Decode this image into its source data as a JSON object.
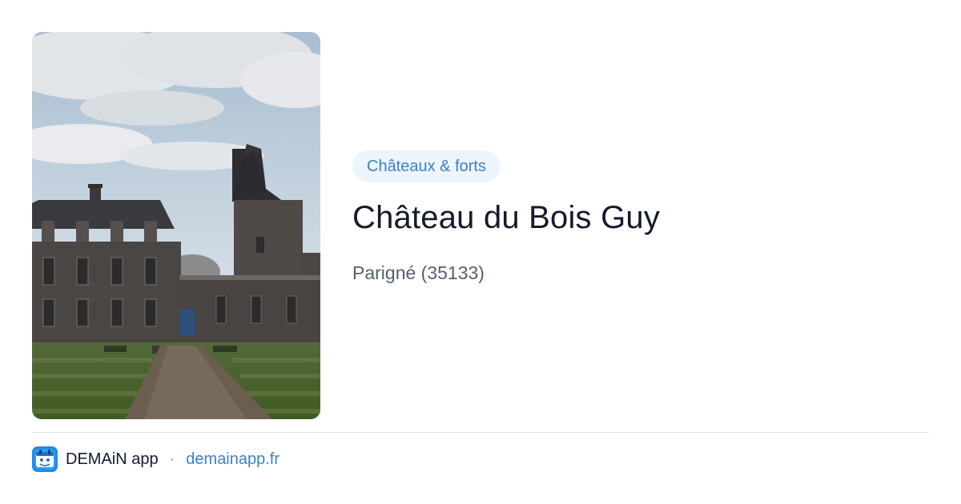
{
  "card": {
    "category": "Châteaux & forts",
    "title": "Château du Bois Guy",
    "location": "Parigné (35133)"
  },
  "footer": {
    "app_name": "DEMAiN app",
    "separator": "·",
    "link": "demainapp.fr"
  },
  "colors": {
    "accent": "#3b82c9",
    "tag_background": "#eef4fc",
    "title": "#141a2c",
    "subtitle": "#54606e",
    "divider": "#d9e2ea"
  },
  "icons": {
    "app_icon": "demain-app-icon"
  }
}
